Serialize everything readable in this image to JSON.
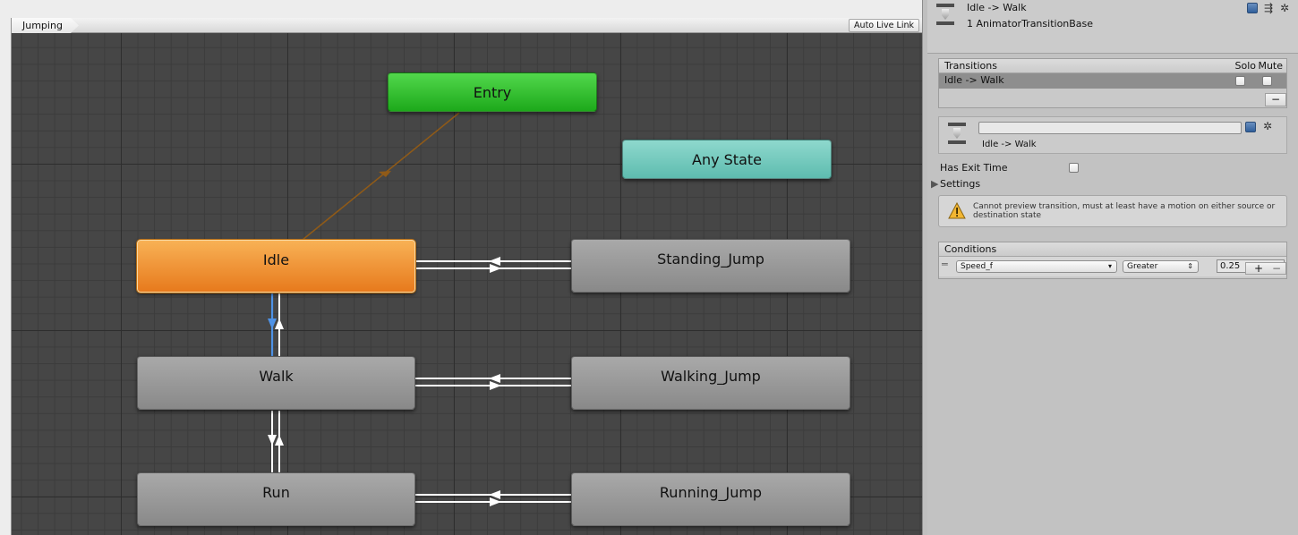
{
  "graph": {
    "breadcrumb": "Jumping",
    "auto_live_link": "Auto Live Link",
    "states": {
      "entry": "Entry",
      "any_state": "Any State",
      "idle": "Idle",
      "walk": "Walk",
      "run": "Run",
      "standing_jump": "Standing_Jump",
      "walking_jump": "Walking_Jump",
      "running_jump": "Running_Jump"
    }
  },
  "inspector": {
    "header": {
      "title": "Idle -> Walk",
      "subtitle": "1 AnimatorTransitionBase"
    },
    "transitions": {
      "header": "Transitions",
      "solo": "Solo",
      "mute": "Mute",
      "rows": [
        {
          "name": "Idle -> Walk"
        }
      ],
      "remove": "−"
    },
    "settings_box": {
      "name_value": "",
      "subtitle": "Idle -> Walk"
    },
    "has_exit_time_label": "Has Exit Time",
    "settings_label": "Settings",
    "warning": "Cannot preview transition, must at least have a motion on either source or destination state",
    "conditions": {
      "header": "Conditions",
      "parameter": "Speed_f",
      "mode": "Greater",
      "value": "0.25",
      "add": "+",
      "remove": "−"
    }
  },
  "colors": {
    "entry": "#1da91b",
    "any_state": "#5ebcaf",
    "idle": "#e77a1d",
    "selected_transition": "#4e92e6"
  }
}
